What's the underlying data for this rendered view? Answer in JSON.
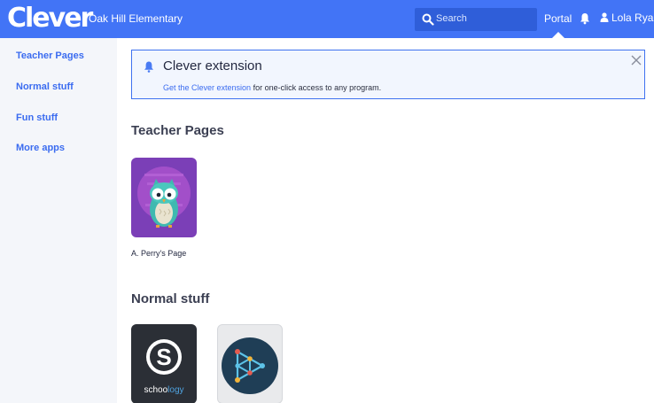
{
  "header": {
    "logo_text": "Clever",
    "district": "Oak Hill Elementary",
    "search_placeholder": "Search",
    "portal_label": "Portal",
    "user_name": "Lola Ryan",
    "bar_color": "#4274f6",
    "icons": [
      "search-icon",
      "bell-icon",
      "user-icon",
      "chevron-down-icon"
    ]
  },
  "sidebar": {
    "items": [
      {
        "label": "Teacher Pages"
      },
      {
        "label": "Normal stuff"
      },
      {
        "label": "Fun stuff"
      },
      {
        "label": "More apps"
      }
    ]
  },
  "banner": {
    "title": "Clever extension",
    "link_text": "Get the Clever extension",
    "rest_text": " for one-click access to any program.",
    "icons": [
      "bell-icon",
      "close-icon"
    ]
  },
  "sections": [
    {
      "title": "Teacher Pages",
      "apps": [
        {
          "label": "A. Perry's Page",
          "icon": "owl-icon"
        }
      ]
    },
    {
      "title": "Normal stuff",
      "apps": [
        {
          "label": "schoology",
          "icon": "schoology-logo"
        },
        {
          "label": "",
          "icon": "network-logo"
        }
      ]
    }
  ],
  "accent_color": "#3b6cf0"
}
